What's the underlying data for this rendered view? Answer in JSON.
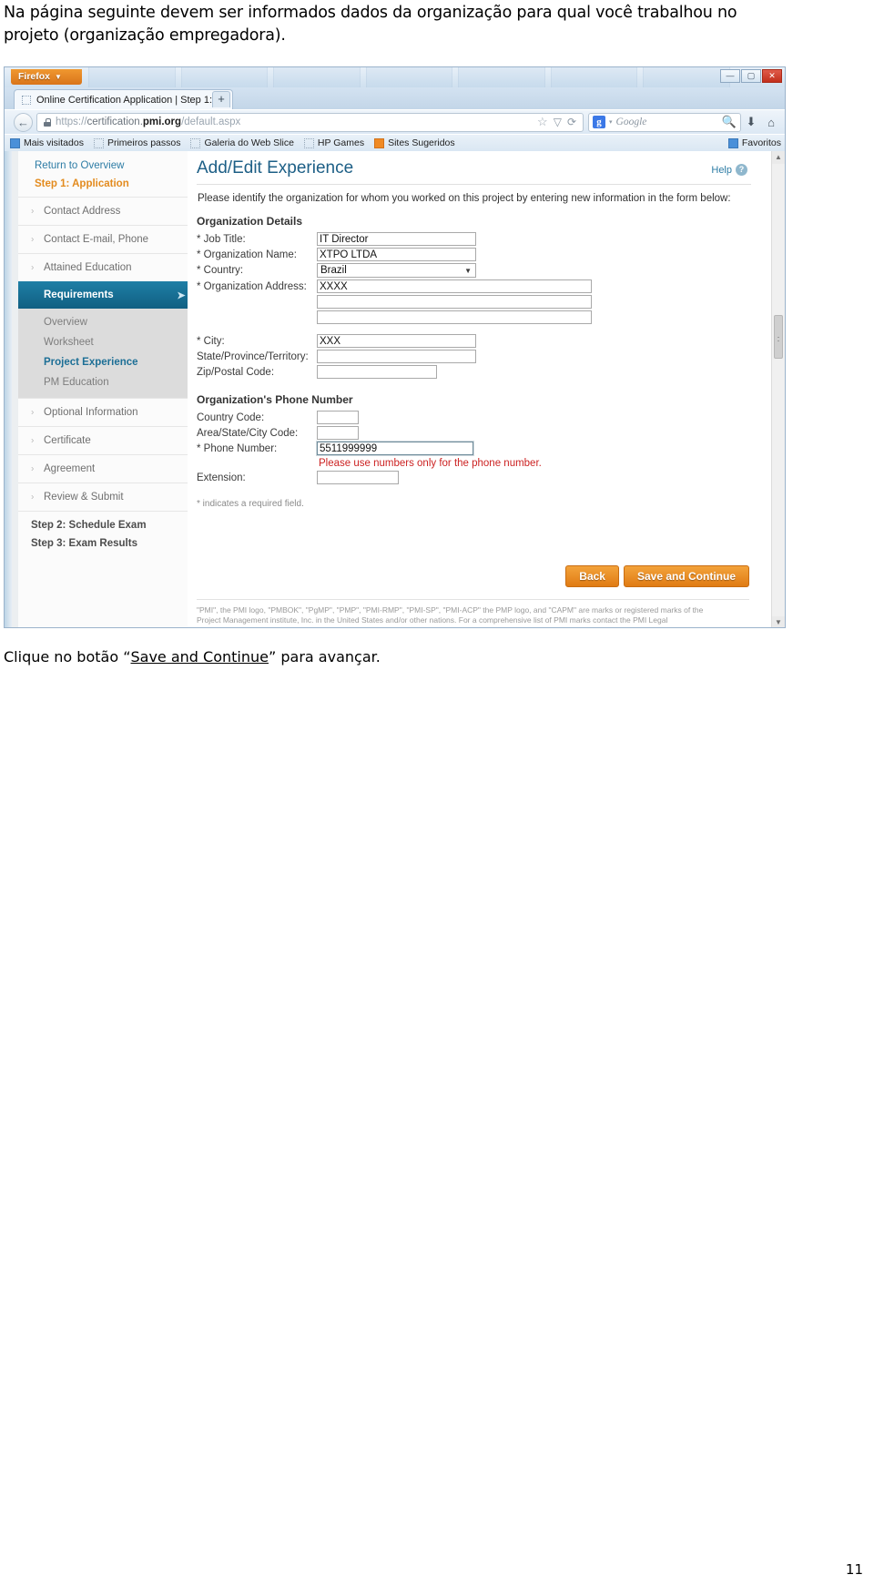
{
  "intro_text": "Na página seguinte devem ser informados dados da organização para qual você trabalhou no projeto (organização empregadora).",
  "caption": {
    "before": "Clique no botão “",
    "link": "Save and Continue",
    "after": "” para avançar."
  },
  "page_number": "11",
  "browser": {
    "app_button": "Firefox",
    "app_caret": "▼",
    "window_controls": {
      "minimize": "—",
      "maximize": "▢",
      "close": "✕"
    },
    "tab": {
      "title": "Online Certification Application | Step 1: ...",
      "favicon": "dotted-page-icon"
    },
    "new_tab": "+",
    "back_arrow": "←",
    "url": {
      "scheme": "https://",
      "host_pre": "certification.",
      "host_bold": "pmi.org",
      "path": "/default.aspx"
    },
    "url_icons": {
      "star": "☆",
      "caret": "▽",
      "reload": "⟳"
    },
    "search": {
      "engine_logo": "g",
      "engine_caret": "▾",
      "placeholder": "Google",
      "magnifier": "search-icon"
    },
    "toolbar_icons": {
      "downloads": "⬇",
      "home": "⌂"
    },
    "bookmarks": [
      {
        "label": "Mais visitados",
        "icon": "blue-favicon"
      },
      {
        "label": "Primeiros passos",
        "icon": "dotted-favicon"
      },
      {
        "label": "Galeria do Web Slice",
        "icon": "dotted-favicon"
      },
      {
        "label": "HP Games",
        "icon": "dotted-favicon"
      },
      {
        "label": "Sites Sugeridos",
        "icon": "orange-favicon"
      }
    ],
    "favorites_label": "Favoritos"
  },
  "sidebar": {
    "return_link": "Return to Overview",
    "step_title": "Step 1: Application",
    "items": [
      {
        "label": "Contact Address"
      },
      {
        "label": "Contact E-mail, Phone"
      },
      {
        "label": "Attained Education"
      }
    ],
    "active_item": "Requirements",
    "sub_items": [
      {
        "label": "Overview",
        "current": false
      },
      {
        "label": "Worksheet",
        "current": false
      },
      {
        "label": "Project Experience",
        "current": true
      },
      {
        "label": "PM Education",
        "current": false
      }
    ],
    "items_after": [
      {
        "label": "Optional Information"
      },
      {
        "label": "Certificate"
      },
      {
        "label": "Agreement"
      },
      {
        "label": "Review & Submit"
      }
    ],
    "footer_steps": [
      {
        "label": "Step 2: Schedule Exam"
      },
      {
        "label": "Step 3: Exam Results"
      }
    ]
  },
  "page": {
    "title": "Add/Edit Experience",
    "help_label": "Help",
    "help_icon": "question-mark-icon",
    "lead": "Please identify the organization for whom you worked on this project by entering new information in the form below:",
    "section_org": "Organization Details",
    "fields": {
      "job_title": {
        "label": "* Job Title:",
        "value": "IT Director"
      },
      "org_name": {
        "label": "* Organization Name:",
        "value": "XTPO LTDA"
      },
      "country": {
        "label": "* Country:",
        "value": "Brazil"
      },
      "org_address": {
        "label": "* Organization Address:",
        "value": "XXXX"
      },
      "org_address2": {
        "label": "",
        "value": ""
      },
      "org_address3": {
        "label": "",
        "value": ""
      },
      "city": {
        "label": "* City:",
        "value": "XXX"
      },
      "state": {
        "label": "State/Province/Territory:",
        "value": ""
      },
      "zip": {
        "label": "Zip/Postal Code:",
        "value": ""
      }
    },
    "section_phone": "Organization's Phone Number",
    "phone_fields": {
      "country_code": {
        "label": "Country Code:",
        "value": ""
      },
      "area_code": {
        "label": "Area/State/City Code:",
        "value": ""
      },
      "phone_number": {
        "label": "* Phone Number:",
        "value": "5511999999"
      },
      "extension": {
        "label": "Extension:",
        "value": ""
      }
    },
    "phone_error": "Please use numbers only for the phone number.",
    "required_note": "* indicates a required field.",
    "buttons": {
      "back": "Back",
      "save": "Save and Continue"
    },
    "legal_line1": "\"PMI\", the PMI logo, \"PMBOK\", \"PgMP\", \"PMP\", \"PMI-RMP\", \"PMI-SP\", \"PMI-ACP\" the PMP logo, and \"CAPM\" are marks or registered marks of the",
    "legal_line2": "Project Management institute, Inc. in the United States and/or other nations. For a comprehensive list of PMI marks contact the PMI Legal"
  }
}
